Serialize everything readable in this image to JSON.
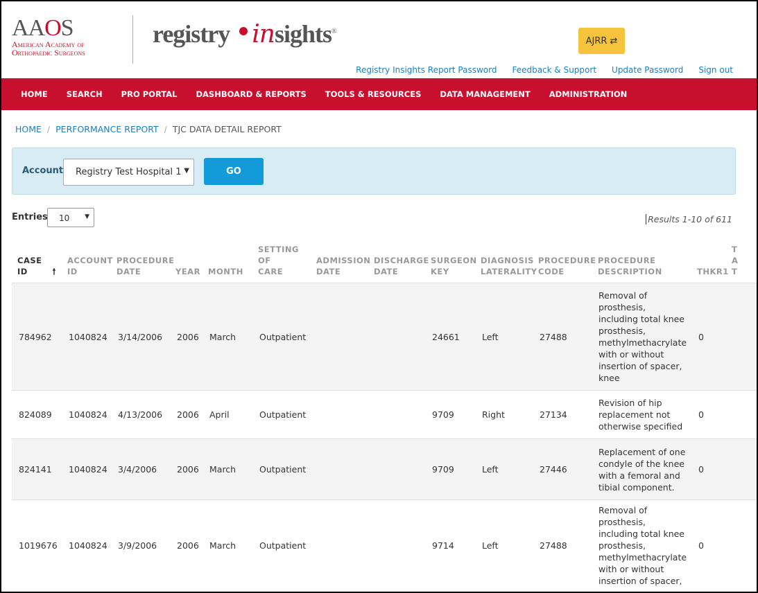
{
  "logo": {
    "aaos": "AAOS",
    "aaos_sub1": "American Academy of",
    "aaos_sub2": "Orthopaedic Surgeons",
    "product_a": "registry",
    "product_b": "in",
    "product_c": "sights",
    "reg": "®"
  },
  "ajrr_button": {
    "label": "AJRR",
    "icon": "swap-icon"
  },
  "top_links": [
    "Registry Insights Report Password",
    "Feedback & Support",
    "Update Password",
    "Sign out"
  ],
  "nav": [
    "HOME",
    "SEARCH",
    "PRO PORTAL",
    "DASHBOARD & REPORTS",
    "TOOLS & RESOURCES",
    "DATA MANAGEMENT",
    "ADMINISTRATION"
  ],
  "breadcrumb": [
    "HOME",
    "PERFORMANCE REPORT",
    "TJC DATA DETAIL REPORT"
  ],
  "filter": {
    "label": "Account",
    "account": "Registry Test Hospital 1",
    "go": "GO"
  },
  "entries": {
    "label": "Entries",
    "value": "10"
  },
  "results": "Results 1-10 of 611",
  "colors": {
    "nav": "#c8102e",
    "link": "#1a7fc1",
    "go": "#129bd8",
    "ajrr": "#f6c33d"
  },
  "table": {
    "headers": [
      [
        "CASE",
        "ID"
      ],
      [
        "ACCOUNT",
        "ID"
      ],
      [
        "PROCEDURE",
        "DATE"
      ],
      [
        "",
        "YEAR"
      ],
      [
        "",
        "MONTH"
      ],
      [
        "SETTING OF",
        "CARE"
      ],
      [
        "ADMISSION",
        "DATE"
      ],
      [
        "DISCHARGE",
        "DATE"
      ],
      [
        "SURGEON",
        "KEY"
      ],
      [
        "DIAGNOSIS",
        "LATERALITY"
      ],
      [
        "PROCEDURE",
        "CODE"
      ],
      [
        "PROCEDURE",
        "DESCRIPTION"
      ],
      [
        "",
        "THKR1"
      ],
      [
        "T",
        "A",
        "T"
      ]
    ],
    "rows": [
      [
        "784962",
        "1040824",
        "3/14/2006",
        "2006",
        "March",
        "Outpatient",
        "",
        "",
        "24661",
        "Left",
        "27488",
        "Removal of prosthesis, including total knee prosthesis, methylmethacrylate with or without insertion of spacer, knee",
        "0",
        ""
      ],
      [
        "824089",
        "1040824",
        "4/13/2006",
        "2006",
        "April",
        "Outpatient",
        "",
        "",
        "9709",
        "Right",
        "27134",
        "Revision of hip replacement not otherwise specified",
        "0",
        ""
      ],
      [
        "824141",
        "1040824",
        "3/4/2006",
        "2006",
        "March",
        "Outpatient",
        "",
        "",
        "9709",
        "Left",
        "27446",
        "Replacement of one condyle of the knee with a femoral and tibial component.",
        "0",
        ""
      ],
      [
        "1019676",
        "1040824",
        "3/9/2006",
        "2006",
        "March",
        "Outpatient",
        "",
        "",
        "9714",
        "Left",
        "27488",
        "Removal of prosthesis, including total knee prosthesis, methylmethacrylate with or without insertion of spacer,",
        "0",
        ""
      ]
    ]
  }
}
